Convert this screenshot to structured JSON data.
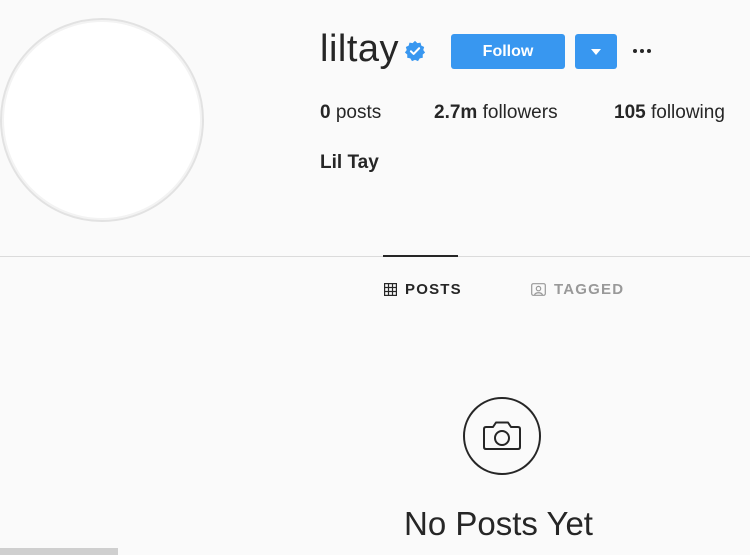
{
  "profile": {
    "username": "liltay",
    "full_name": "Lil Tay",
    "verified": true
  },
  "actions": {
    "follow_label": "Follow",
    "more_icon": "ellipsis-icon",
    "dropdown_icon": "chevron-down-icon"
  },
  "stats": {
    "posts": {
      "value": "0",
      "label": "posts"
    },
    "followers": {
      "value": "2.7m",
      "label": "followers"
    },
    "following": {
      "value": "105",
      "label": "following"
    }
  },
  "tabs": [
    {
      "label": "POSTS",
      "icon": "grid-icon",
      "active": true
    },
    {
      "label": "TAGGED",
      "icon": "tagged-icon",
      "active": false
    }
  ],
  "empty_state": {
    "icon": "camera-icon",
    "title": "No Posts Yet"
  },
  "colors": {
    "accent": "#3897f0",
    "background": "#fafafa",
    "text": "#262626",
    "muted": "#999999"
  }
}
